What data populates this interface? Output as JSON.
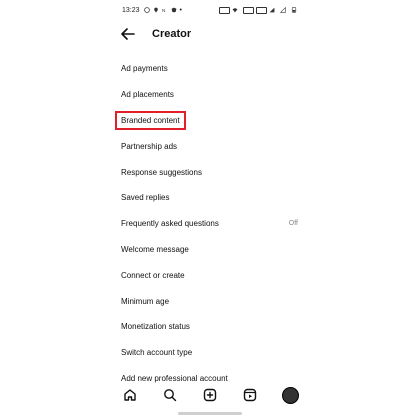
{
  "status_bar": {
    "time": "13:23",
    "data_speed": "5.00\nKB/s"
  },
  "header": {
    "title": "Creator"
  },
  "menu": {
    "items": [
      {
        "label": "Ad payments",
        "value": ""
      },
      {
        "label": "Ad placements",
        "value": ""
      },
      {
        "label": "Branded content",
        "value": "",
        "highlighted": true
      },
      {
        "label": "Partnership ads",
        "value": ""
      },
      {
        "label": "Response suggestions",
        "value": ""
      },
      {
        "label": "Saved replies",
        "value": ""
      },
      {
        "label": "Frequently asked questions",
        "value": "Off"
      },
      {
        "label": "Welcome message",
        "value": ""
      },
      {
        "label": "Connect or create",
        "value": ""
      },
      {
        "label": "Minimum age",
        "value": ""
      },
      {
        "label": "Monetization status",
        "value": ""
      },
      {
        "label": "Switch account type",
        "value": ""
      },
      {
        "label": "Add new professional account",
        "value": ""
      }
    ]
  },
  "nav": {
    "items": [
      "home-icon",
      "search-icon",
      "create-icon",
      "reels-icon",
      "profile-avatar"
    ]
  },
  "colors": {
    "highlight": "#e2202b"
  }
}
